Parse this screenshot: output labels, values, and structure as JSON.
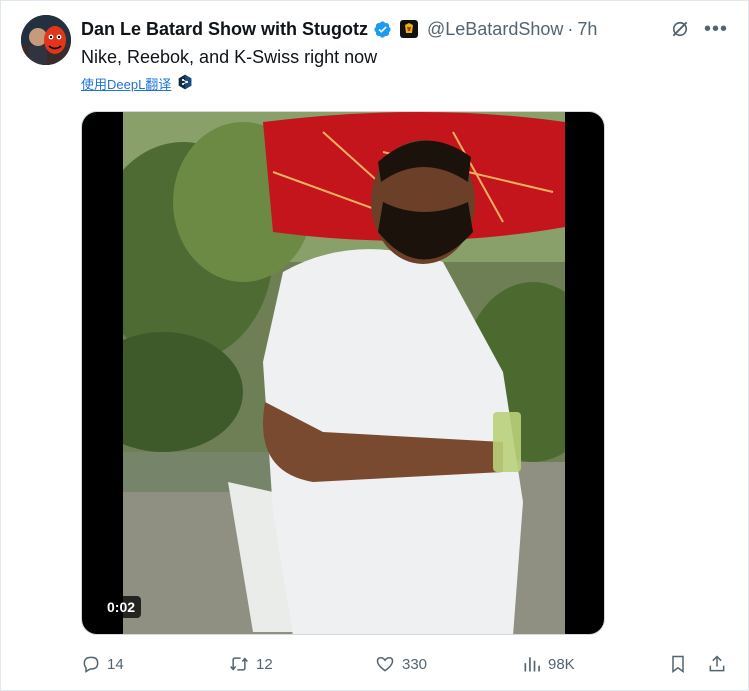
{
  "tweet": {
    "author_name": "Dan Le Batard Show with Stugotz",
    "handle": "@LeBatardShow",
    "separator": "·",
    "time": "7h",
    "text": "Nike, Reebok, and K-Swiss right now",
    "translate_label": "使用DeepL翻译",
    "video_timestamp": "0:02"
  },
  "actions": {
    "replies": "14",
    "reposts": "12",
    "likes": "330",
    "views": "98K"
  },
  "colors": {
    "verified": "#1d9bf0",
    "link": "#1d73d6",
    "muted": "#536471"
  }
}
